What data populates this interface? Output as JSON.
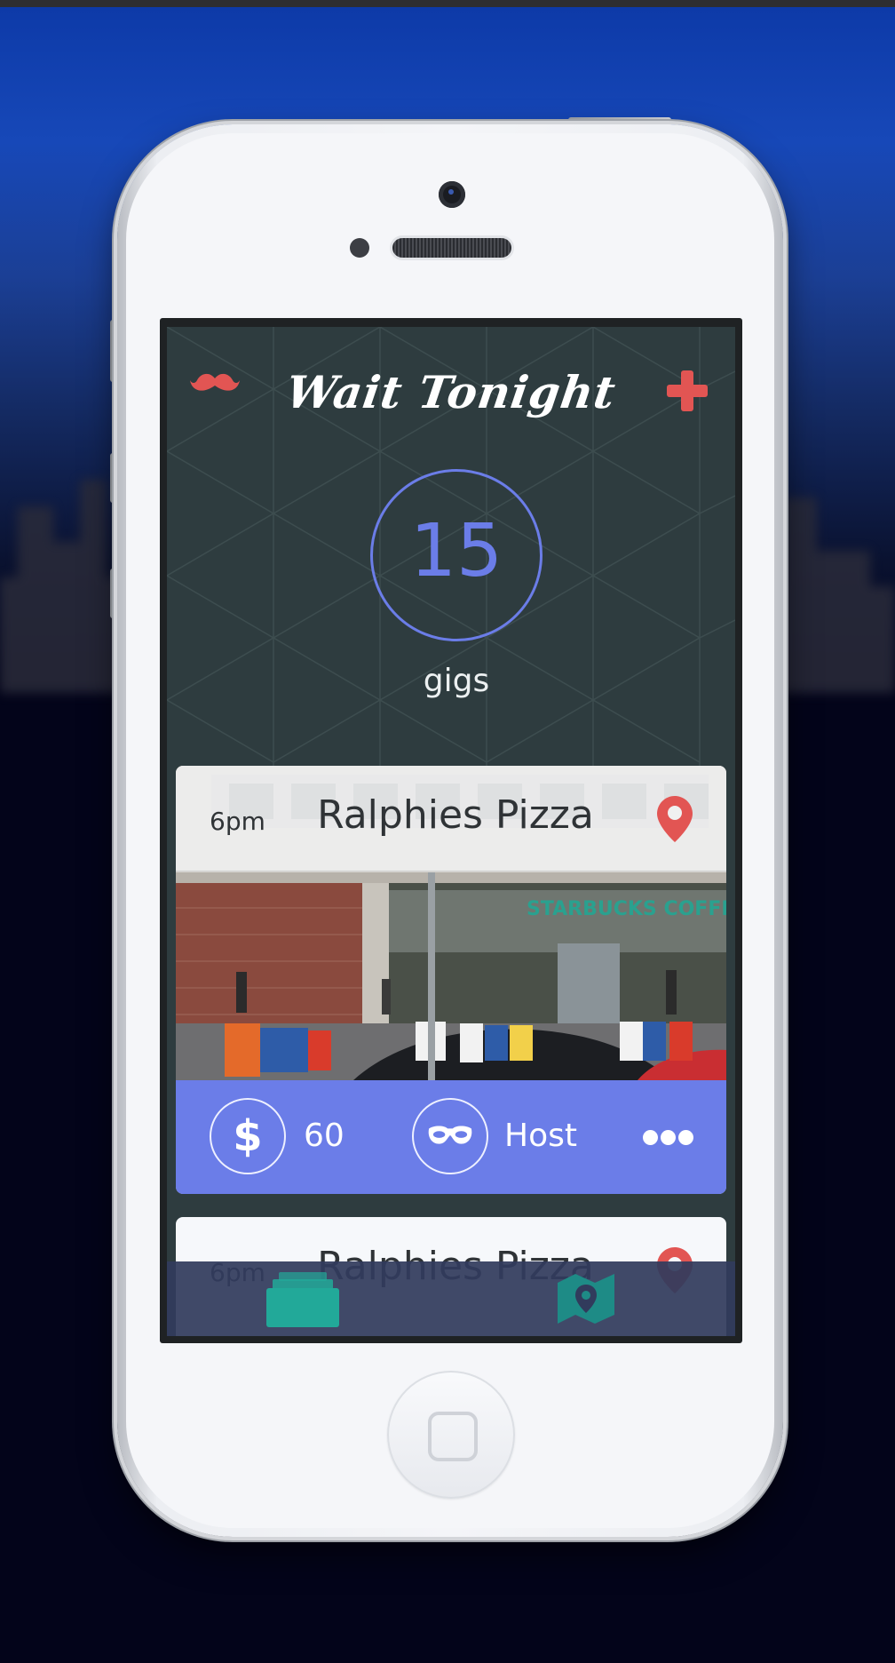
{
  "app": {
    "title": "Wait Tonight",
    "colors": {
      "accent": "#6b7de8",
      "brand_red": "#e25553",
      "teal": "#22a999",
      "background": "#2e3c3f"
    }
  },
  "header": {
    "left_icon": "mustache-icon",
    "right_icon": "plus-icon"
  },
  "counter": {
    "value": "15",
    "label": "gigs"
  },
  "gigs": [
    {
      "time": "6pm",
      "venue": "Ralphies Pizza",
      "pay": "60",
      "role": "Host",
      "icons": [
        "map-pin-icon",
        "dollar-icon",
        "mask-icon",
        "more-icon"
      ]
    },
    {
      "time": "6pm",
      "venue": "Ralphies Pizza"
    }
  ],
  "tabbar": {
    "tabs": [
      {
        "name": "gigs",
        "icon": "card-stack-icon",
        "active": true
      },
      {
        "name": "map",
        "icon": "map-icon",
        "active": false
      }
    ]
  }
}
